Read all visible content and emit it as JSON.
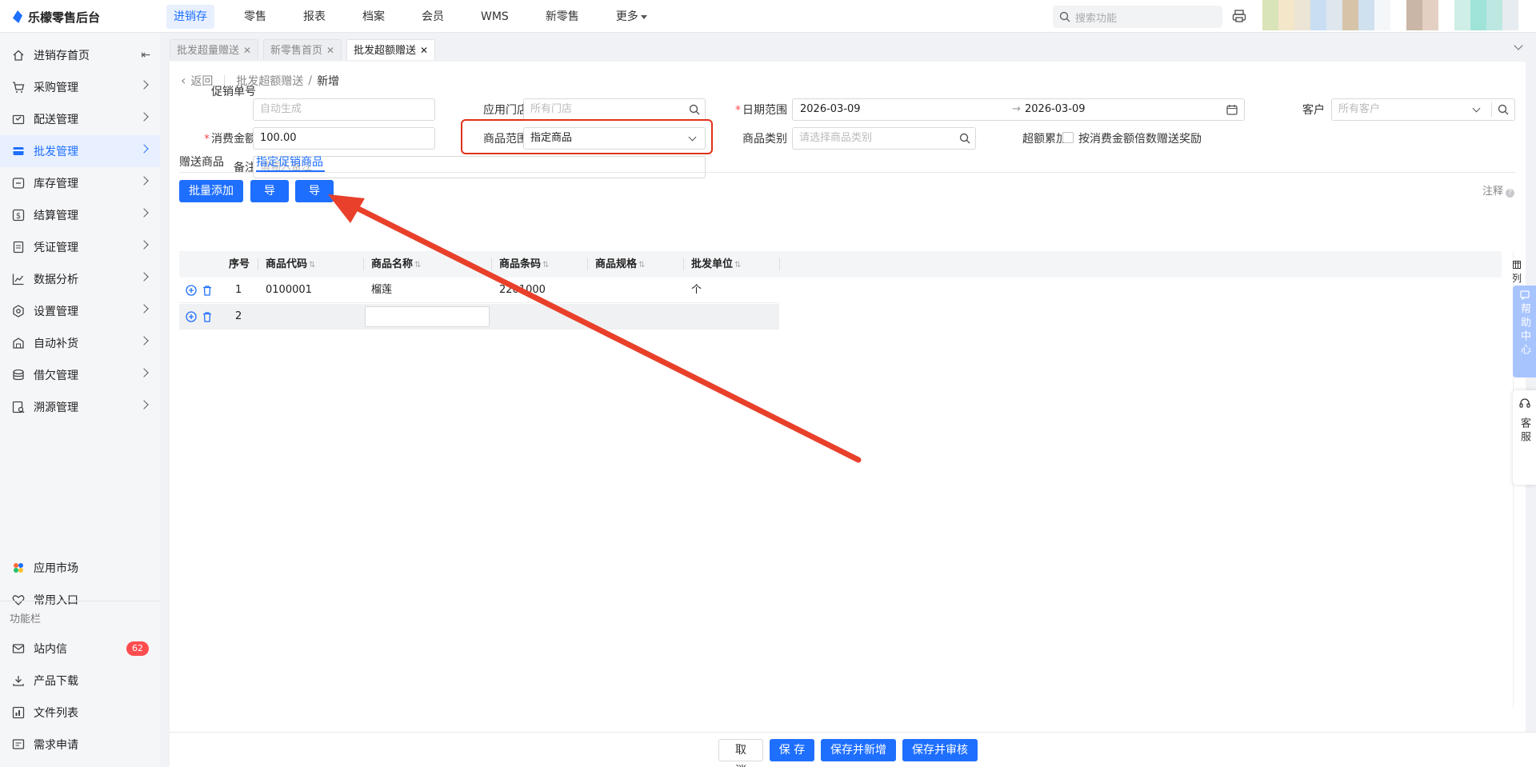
{
  "app": {
    "title": "乐檬零售后台"
  },
  "top_nav": [
    {
      "label": "进销存",
      "active": true
    },
    {
      "label": "零售"
    },
    {
      "label": "报表"
    },
    {
      "label": "档案"
    },
    {
      "label": "会员"
    },
    {
      "label": "WMS"
    },
    {
      "label": "新零售"
    },
    {
      "label": "更多"
    }
  ],
  "search": {
    "placeholder": "搜索功能"
  },
  "sidebar": {
    "items": [
      {
        "label": "进销存首页",
        "icon": "home-icon"
      },
      {
        "label": "采购管理",
        "icon": "cart-icon"
      },
      {
        "label": "配送管理",
        "icon": "delivery-icon"
      },
      {
        "label": "批发管理",
        "icon": "wholesale-icon",
        "active": true
      },
      {
        "label": "库存管理",
        "icon": "inventory-icon"
      },
      {
        "label": "结算管理",
        "icon": "settlement-icon"
      },
      {
        "label": "凭证管理",
        "icon": "voucher-icon"
      },
      {
        "label": "数据分析",
        "icon": "chart-icon"
      },
      {
        "label": "设置管理",
        "icon": "settings-icon"
      },
      {
        "label": "自动补货",
        "icon": "replenish-icon"
      },
      {
        "label": "借欠管理",
        "icon": "debt-icon"
      },
      {
        "label": "溯源管理",
        "icon": "trace-icon"
      }
    ],
    "bottom_items": [
      {
        "label": "应用市场",
        "icon": "app-market-icon"
      },
      {
        "label": "常用入口",
        "icon": "heart-icon"
      }
    ],
    "section_label": "功能栏",
    "tools": [
      {
        "label": "站内信",
        "icon": "mail-icon",
        "badge": "62"
      },
      {
        "label": "产品下载",
        "icon": "download-icon"
      },
      {
        "label": "文件列表",
        "icon": "file-list-icon"
      },
      {
        "label": "需求申请",
        "icon": "request-icon"
      }
    ]
  },
  "tabs": [
    {
      "label": "批发超量赠送"
    },
    {
      "label": "新零售首页"
    },
    {
      "label": "批发超额赠送",
      "active": true
    }
  ],
  "breadcrumb": {
    "back": "返回",
    "parent": "批发超额赠送",
    "separator": "/",
    "current": "新增"
  },
  "form": {
    "promo_no": {
      "label": "促销单号",
      "placeholder": "自动生成"
    },
    "store": {
      "label": "应用门店",
      "placeholder": "所有门店"
    },
    "date_range": {
      "label": "日期范围",
      "start": "2026-03-09",
      "end": "2026-03-09",
      "arrow": "→"
    },
    "customer": {
      "label": "客户",
      "placeholder": "所有客户"
    },
    "amount": {
      "label": "消费金额",
      "value": "100.00"
    },
    "scope": {
      "label": "商品范围",
      "value": "指定商品"
    },
    "category": {
      "label": "商品类别",
      "placeholder": "请选择商品类别"
    },
    "accumulate": {
      "label": "超额累加",
      "checkbox_label": "按消费金额倍数赠送奖励"
    },
    "remark": {
      "label": "备注",
      "placeholder": "请输入备注"
    }
  },
  "subtabs": [
    {
      "label": "赠送商品"
    },
    {
      "label": "指定促销商品",
      "active": true
    }
  ],
  "actions": {
    "batch_add": "批量添加",
    "import": "导 入",
    "export": "导 出",
    "note": "注释",
    "columns": "列"
  },
  "table": {
    "columns": [
      "序号",
      "商品代码",
      "商品名称",
      "商品条码",
      "商品规格",
      "批发单位"
    ],
    "rows": [
      {
        "no": "1",
        "code": "0100001",
        "name": "榴莲",
        "barcode": "2201000",
        "spec": "",
        "unit": "个"
      },
      {
        "no": "2",
        "code": "",
        "name": "",
        "barcode": "",
        "spec": "",
        "unit": ""
      }
    ]
  },
  "footer": {
    "cancel": "取 消",
    "save": "保 存",
    "save_new": "保存并新增",
    "save_audit": "保存并审核"
  },
  "floating": {
    "help": "帮助中心",
    "service": "客服"
  },
  "colors": {
    "accent": "#1f6fff",
    "annotation": "#e0321a",
    "badge": "#ff4d4f"
  }
}
